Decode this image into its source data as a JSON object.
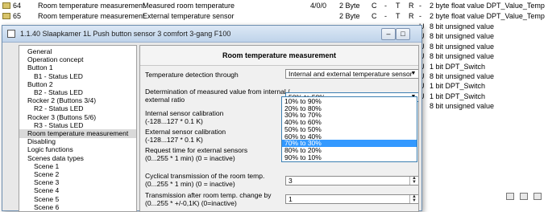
{
  "background_rows": [
    {
      "num": "64",
      "name": "Room temperature measurement",
      "func": "Measured room temperature",
      "addr": "4/0/0",
      "size": "2 Byte",
      "c": "C",
      "r": "-",
      "t": "T",
      "rr": "R",
      "u": "-",
      "type": "2 byte float value DPT_Value_Temp"
    },
    {
      "num": "65",
      "name": "Room temperature measurement",
      "func": "External temperature sensor",
      "addr": "",
      "size": "2 Byte",
      "c": "C",
      "r": "-",
      "t": "T",
      "rr": "R",
      "u": "-",
      "type": "2 byte float value DPT_Value_Temp"
    }
  ],
  "right_rows": [
    {
      "u": "U",
      "type": "8 bit unsigned value"
    },
    {
      "u": "U",
      "type": "8 bit unsigned value"
    },
    {
      "u": "U",
      "type": "8 bit unsigned value"
    },
    {
      "u": "U",
      "type": "8 bit unsigned value"
    },
    {
      "u": "U",
      "type": "1 bit DPT_Switch"
    },
    {
      "u": "U",
      "type": "8 bit unsigned value"
    },
    {
      "u": "U",
      "type": "1 bit DPT_Switch"
    },
    {
      "u": "U",
      "type": "1 bit DPT_Switch"
    },
    {
      "u": "-",
      "type": "8 bit unsigned value"
    }
  ],
  "dialog": {
    "title": "1.1.40 Slaapkamer 1L Push button sensor 3 comfort 3-gang F100",
    "minimize": "–",
    "maximize": "□",
    "close": "✕"
  },
  "tree": [
    {
      "label": "General",
      "indent": 0,
      "selected": false
    },
    {
      "label": "Operation concept",
      "indent": 0,
      "selected": false
    },
    {
      "label": "Button 1",
      "indent": 0,
      "selected": false
    },
    {
      "label": "B1 - Status LED",
      "indent": 1,
      "selected": false
    },
    {
      "label": "Button 2",
      "indent": 0,
      "selected": false
    },
    {
      "label": "B2 - Status LED",
      "indent": 1,
      "selected": false
    },
    {
      "label": "Rocker 2 (Buttons 3/4)",
      "indent": 0,
      "selected": false
    },
    {
      "label": "R2 - Status LED",
      "indent": 1,
      "selected": false
    },
    {
      "label": "Rocker 3 (Buttons 5/6)",
      "indent": 0,
      "selected": false
    },
    {
      "label": "R3 - Status LED",
      "indent": 1,
      "selected": false
    },
    {
      "label": "Room temperature measurement",
      "indent": 0,
      "selected": true
    },
    {
      "label": "Disabling",
      "indent": 0,
      "selected": false
    },
    {
      "label": "Logic functions",
      "indent": 0,
      "selected": false
    },
    {
      "label": "Scenes data types",
      "indent": 0,
      "selected": false
    },
    {
      "label": "Scene 1",
      "indent": 1,
      "selected": false
    },
    {
      "label": "Scene 2",
      "indent": 1,
      "selected": false
    },
    {
      "label": "Scene 3",
      "indent": 1,
      "selected": false
    },
    {
      "label": "Scene 4",
      "indent": 1,
      "selected": false
    },
    {
      "label": "Scene 5",
      "indent": 1,
      "selected": false
    },
    {
      "label": "Scene 6",
      "indent": 1,
      "selected": false
    }
  ],
  "panel": {
    "heading": "Room temperature measurement",
    "temp_detection_label": "Temperature detection through",
    "temp_detection_value": "Internal and external temperature sensor",
    "determination_label_1": "Determination of measured value from internal /",
    "determination_label_2": "external ratio",
    "determination_value": "50% to 50%",
    "internal_cal_label_1": "Internal sensor calibration",
    "internal_cal_label_2": "(-128...127 * 0.1 K)",
    "external_cal_label_1": "External sensor calibration",
    "external_cal_label_2": "(-128...127 * 0.1 K)",
    "request_label_1": "Request time for external sensors",
    "request_label_2": "(0...255 * 1 min) (0 = inactive)",
    "cyclical_label_1": "Cyclical transmission of the room temp.",
    "cyclical_label_2": "(0...255 * 1 min) (0 = inactive)",
    "cyclical_value": "3",
    "transmission_label_1": "Transmission after room temp. change by",
    "transmission_label_2": "(0...255 * +/-0,1K) (0=inactive)",
    "transmission_value": "1"
  },
  "dropdown_options": [
    "10% to 90%",
    "20% to 80%",
    "30% to 70%",
    "40% to 60%",
    "50% to 50%",
    "60% to 40%",
    "70% to 30%",
    "80% to 20%",
    "90% to 10%"
  ],
  "dropdown_highlighted": "70% to 30%"
}
